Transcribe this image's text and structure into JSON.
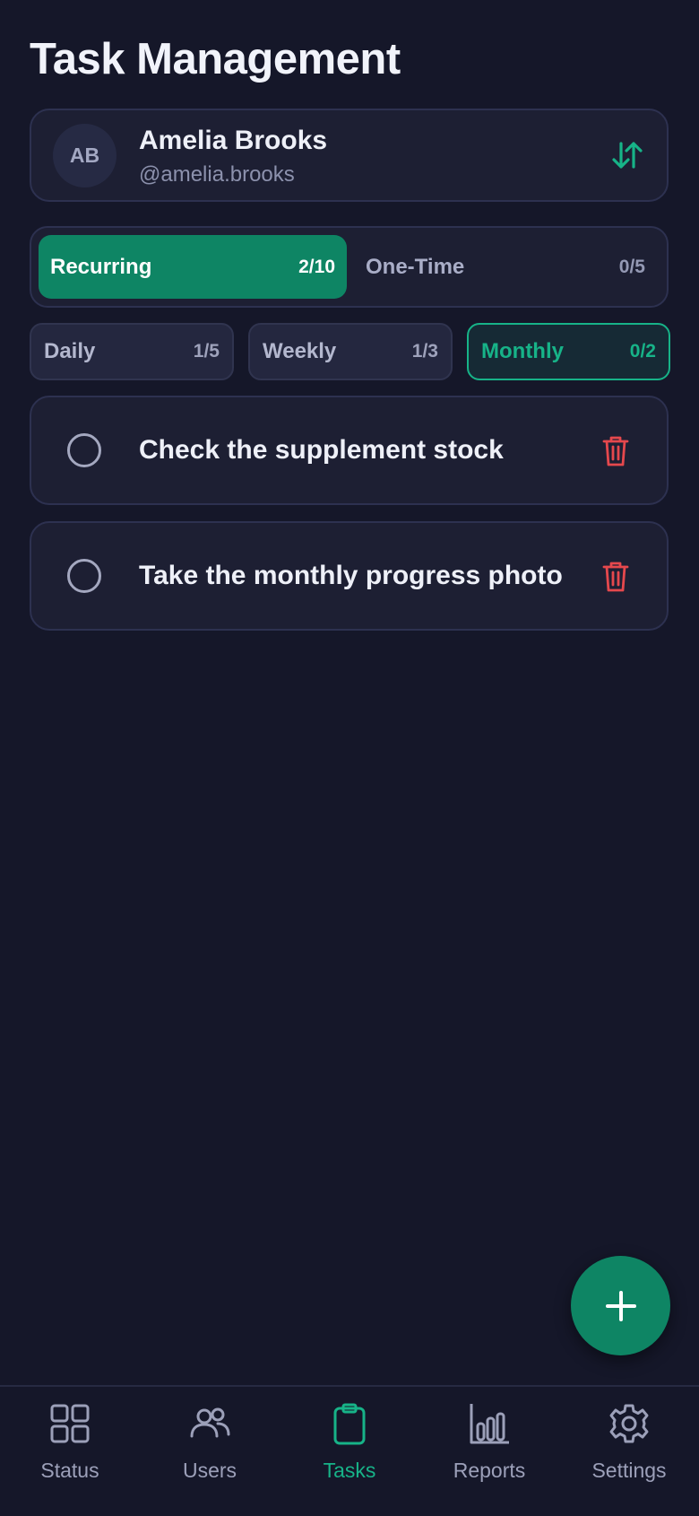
{
  "page": {
    "title": "Task Management"
  },
  "user": {
    "initials": "AB",
    "name": "Amelia Brooks",
    "handle": "@amelia.brooks",
    "switch_icon": "swap-vertical-icon"
  },
  "task_types": [
    {
      "label": "Recurring",
      "count": "2/10",
      "active": true
    },
    {
      "label": "One-Time",
      "count": "0/5",
      "active": false
    }
  ],
  "frequency_tabs": [
    {
      "label": "Daily",
      "count": "1/5",
      "active": false
    },
    {
      "label": "Weekly",
      "count": "1/3",
      "active": false
    },
    {
      "label": "Monthly",
      "count": "0/2",
      "active": true
    }
  ],
  "tasks": [
    {
      "title": "Check the supplement stock",
      "completed": false
    },
    {
      "title": "Take the monthly progress photo",
      "completed": false
    }
  ],
  "fab": {
    "icon": "plus-icon"
  },
  "nav": {
    "items": [
      {
        "label": "Status",
        "icon": "grid-icon",
        "active": false
      },
      {
        "label": "Users",
        "icon": "users-icon",
        "active": false
      },
      {
        "label": "Tasks",
        "icon": "clipboard-icon",
        "active": true
      },
      {
        "label": "Reports",
        "icon": "bar-chart-icon",
        "active": false
      },
      {
        "label": "Settings",
        "icon": "gear-icon",
        "active": false
      }
    ]
  },
  "colors": {
    "background": "#151729",
    "card": "#1d1f33",
    "accent": "#0e8564",
    "accent_text": "#17b388",
    "danger": "#e5484d",
    "muted": "#9ca0b9"
  }
}
